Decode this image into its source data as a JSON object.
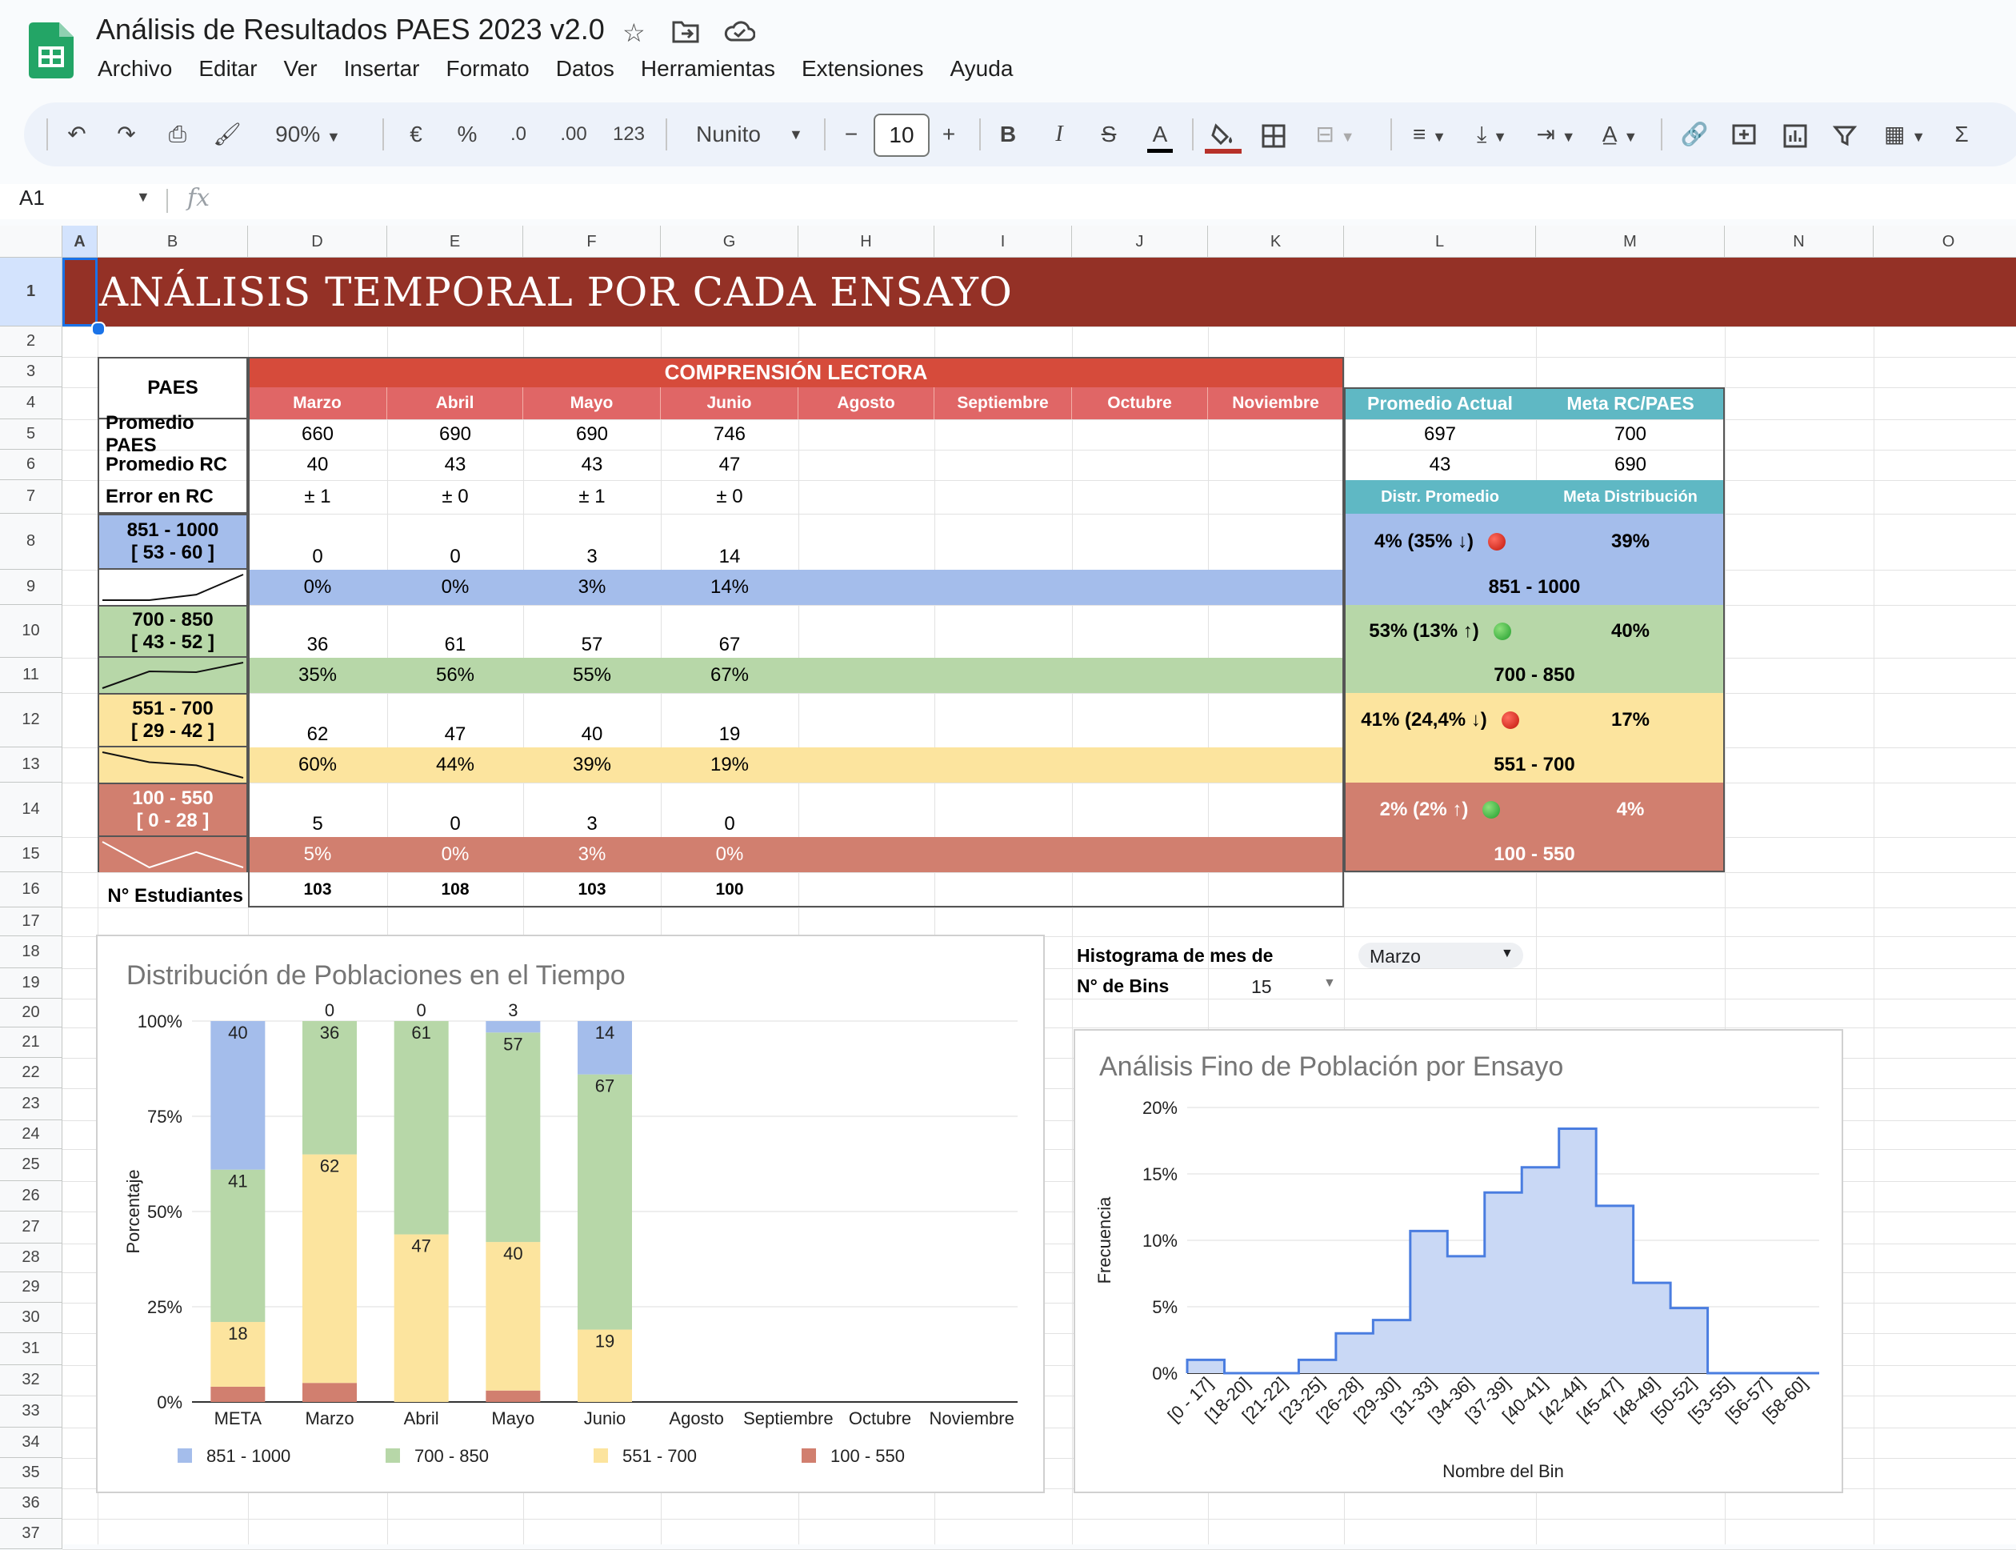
{
  "app": {
    "doc_title": "Análisis de Resultados PAES 2023 v2.0",
    "menu": [
      "Archivo",
      "Editar",
      "Ver",
      "Insertar",
      "Formato",
      "Datos",
      "Herramientas",
      "Extensiones",
      "Ayuda"
    ]
  },
  "toolbar": {
    "zoom": "90%",
    "currency": "€",
    "percent": "%",
    "dec_less": ".0",
    "dec_more": ".00",
    "format_num": "123",
    "font": "Nunito",
    "font_size": "10",
    "minus": "−",
    "plus": "+",
    "bold": "B",
    "italic": "I",
    "strike": "S",
    "text_color": "A",
    "sum": "Σ"
  },
  "formula_bar": {
    "cell_ref": "A1",
    "fx": "fx",
    "value": ""
  },
  "columns": [
    "A",
    "B",
    "D",
    "E",
    "F",
    "G",
    "H",
    "I",
    "J",
    "K",
    "L",
    "M",
    "N",
    "O"
  ],
  "rows": [
    "1",
    "2",
    "3",
    "4",
    "5",
    "6",
    "7",
    "8",
    "9",
    "10",
    "11",
    "12",
    "13",
    "14",
    "15",
    "16",
    "17",
    "18",
    "19",
    "20",
    "21",
    "22",
    "23",
    "24",
    "25",
    "26",
    "27",
    "28",
    "29",
    "30",
    "31",
    "32",
    "33",
    "34",
    "35",
    "36",
    "37"
  ],
  "sheet": {
    "banner": "ANÁLISIS TEMPORAL POR CADA ENSAYO",
    "paes_label": "PAES",
    "section_title": "COMPRENSIÓN LECTORA",
    "months": [
      "Marzo",
      "Abril",
      "Mayo",
      "Junio",
      "Agosto",
      "Septiembre",
      "Octubre",
      "Noviembre"
    ],
    "row_labels": {
      "promedio_paes": "Promedio PAES",
      "promedio_rc": "Promedio RC",
      "error_rc": "Error en RC",
      "n_estudiantes": "N° Estudiantes"
    },
    "promedio_paes": [
      "660",
      "690",
      "690",
      "746"
    ],
    "promedio_rc": [
      "40",
      "43",
      "43",
      "47"
    ],
    "error_rc": [
      "± 1",
      "± 0",
      "± 1",
      "± 0"
    ],
    "bands": [
      {
        "range": "851 - 1000",
        "rc": "[ 53 - 60 ]",
        "counts": [
          "0",
          "0",
          "3",
          "14"
        ],
        "pcts": [
          "0%",
          "0%",
          "3%",
          "14%"
        ],
        "color": "#a4bdeb",
        "spark": [
          0,
          0,
          3,
          14
        ]
      },
      {
        "range": "700 - 850",
        "rc": "[ 43 - 52 ]",
        "counts": [
          "36",
          "61",
          "57",
          "67"
        ],
        "pcts": [
          "35%",
          "56%",
          "55%",
          "67%"
        ],
        "color": "#b7d7a8",
        "spark": [
          35,
          56,
          55,
          67
        ]
      },
      {
        "range": "551 - 700",
        "rc": "[ 29 - 42 ]",
        "counts": [
          "62",
          "47",
          "40",
          "19"
        ],
        "pcts": [
          "60%",
          "44%",
          "39%",
          "19%"
        ],
        "color": "#fce49e",
        "spark": [
          60,
          44,
          39,
          19
        ]
      },
      {
        "range": "100 - 550",
        "rc": "[ 0 - 28 ]",
        "counts": [
          "5",
          "0",
          "3",
          "0"
        ],
        "pcts": [
          "5%",
          "0%",
          "3%",
          "0%"
        ],
        "color": "#d17f6f",
        "spark": [
          5,
          0,
          3,
          0
        ]
      }
    ],
    "n_estudiantes": [
      "103",
      "108",
      "103",
      "100"
    ],
    "summary": {
      "h_promedio": "Promedio Actual",
      "h_meta": "Meta RC/PAES",
      "promedio_paes": "697",
      "meta_paes": "700",
      "promedio_rc": "43",
      "meta_rc": "690",
      "h_distr": "Distr. Promedio",
      "h_meta_distr": "Meta Distribución",
      "bands": [
        {
          "distr": "4% (35% ↓)",
          "status": "red",
          "meta": "39%",
          "range": "851 - 1000"
        },
        {
          "distr": "53% (13% ↑)",
          "status": "green",
          "meta": "40%",
          "range": "700 - 850"
        },
        {
          "distr": "41% (24,4% ↓)",
          "status": "red",
          "meta": "17%",
          "range": "551 - 700"
        },
        {
          "distr": "2% (2% ↑)",
          "status": "green",
          "meta": "4%",
          "range": "100 - 550"
        }
      ]
    },
    "hist_controls": {
      "label_mes": "Histograma de mes de",
      "mes": "Marzo",
      "label_bins": "N° de Bins",
      "bins": "15"
    }
  },
  "colors": {
    "banner": "#943126",
    "section": "#d64b3b",
    "month_row": "#e06666",
    "teal": "#5fb8c4",
    "blue": "#a4bdeb",
    "green": "#b7d7a8",
    "yellow": "#fce49e",
    "red": "#d17f6f",
    "hist": "#4a7de0"
  },
  "chart_data": [
    {
      "type": "bar",
      "stacked": true,
      "title": "Distribución de Poblaciones en el Tiempo",
      "ylabel": "Porcentaje",
      "categories": [
        "META",
        "Marzo",
        "Abril",
        "Mayo",
        "Junio",
        "Agosto",
        "Septiembre",
        "Octubre",
        "Noviembre"
      ],
      "yticks": [
        "0%",
        "25%",
        "50%",
        "75%",
        "100%"
      ],
      "ylim": [
        0,
        100
      ],
      "series": [
        {
          "name": "100 - 550",
          "color": "#d17f6f",
          "values": [
            4,
            5,
            0,
            3,
            0
          ],
          "labels": [
            "4",
            "5",
            "0",
            "3",
            "0"
          ]
        },
        {
          "name": "551 - 700",
          "color": "#fce49e",
          "values": [
            17,
            60,
            44,
            39,
            19
          ],
          "labels": [
            "18",
            "62",
            "47",
            "40",
            "19"
          ]
        },
        {
          "name": "700 - 850",
          "color": "#b7d7a8",
          "values": [
            40,
            35,
            56,
            55,
            67
          ],
          "labels": [
            "41",
            "36",
            "61",
            "57",
            "67"
          ]
        },
        {
          "name": "851 - 1000",
          "color": "#a4bdeb",
          "values": [
            39,
            0,
            0,
            3,
            14
          ],
          "labels": [
            "40",
            "0",
            "0",
            "3",
            "14"
          ]
        }
      ],
      "legend": [
        "851 - 1000",
        "700 - 850",
        "551 - 700",
        "100 - 550"
      ],
      "legend_position": "bottom"
    },
    {
      "type": "area",
      "step": true,
      "title": "Análisis Fino de Población por Ensayo",
      "xlabel": "Nombre del Bin",
      "ylabel": "Frecuencia",
      "categories": [
        "[0 - 17]",
        "[18-20]",
        "[21-22]",
        "[23-25]",
        "[26-28]",
        "[29-30]",
        "[31-33]",
        "[34-36]",
        "[37-39]",
        "[40-41]",
        "[42-44]",
        "[45-47]",
        "[48-49]",
        "[50-52]",
        "[53-55]",
        "[56-57]",
        "[58-60]"
      ],
      "values": [
        1,
        0,
        0,
        1,
        3,
        4,
        10.7,
        8.8,
        13.6,
        15.5,
        18.4,
        12.6,
        6.8,
        4.9,
        0,
        0,
        0
      ],
      "yticks": [
        "0%",
        "5%",
        "10%",
        "15%",
        "20%"
      ],
      "ylim": [
        0,
        20
      ]
    }
  ]
}
